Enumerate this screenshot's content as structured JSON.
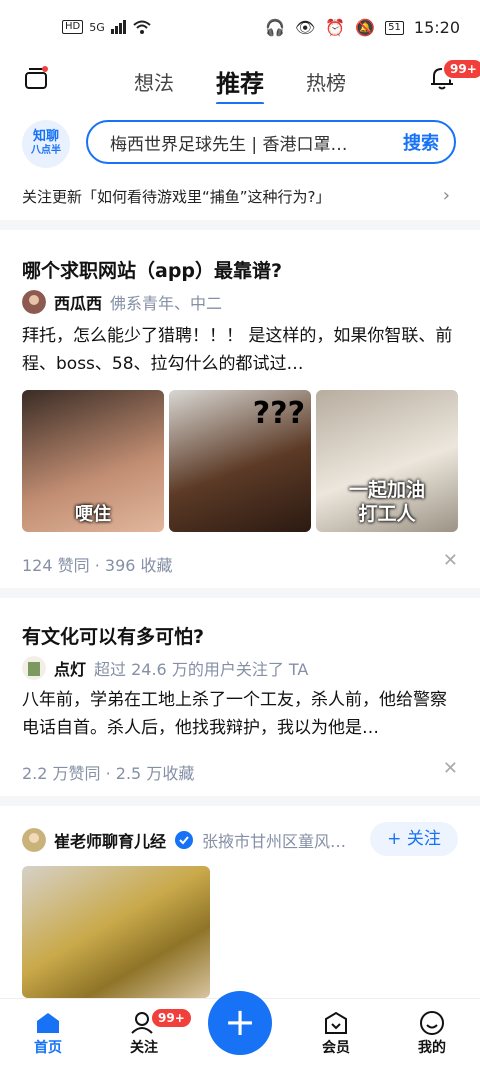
{
  "status_bar": {
    "hd": "HD",
    "network": "5G",
    "battery": "51",
    "time": "15:20"
  },
  "header": {
    "tabs": [
      {
        "label": "想法",
        "active": false
      },
      {
        "label": "推荐",
        "active": true
      },
      {
        "label": "热榜",
        "active": false
      }
    ],
    "notification_badge": "99+"
  },
  "search": {
    "logo_line1": "知聊",
    "logo_line2": "八点半",
    "query": "梅西世界足球先生 | 香港口罩…",
    "button_label": "搜索"
  },
  "follow_update": {
    "text": "关注更新「如何看待游戏里“捕鱼”这种行为?」"
  },
  "feed": [
    {
      "title": "哪个求职网站（app）最靠谱?",
      "author": "西瓜西",
      "author_desc": "佛系青年、中二",
      "excerpt": "拜托，怎么能少了猎聘！！！ 是这样的，如果你智联、前程、boss、58、拉勾什么的都试过…",
      "image_captions": [
        "哽住",
        "???",
        "一起加油\n打工人"
      ],
      "meta": "124 赞同 · 396 收藏"
    },
    {
      "title": "有文化可以有多可怕?",
      "author": "点灯",
      "author_desc": "超过 24.6 万的用户关注了 TA",
      "excerpt": "八年前，学弟在工地上杀了一个工友，杀人前，他给警察电话自首。杀人后，他找我辩护，我以为他是…",
      "meta": "2.2 万赞同 · 2.5 万收藏"
    },
    {
      "author": "崔老师聊育儿经",
      "author_desc": "张掖市甘州区童风…",
      "follow_label": "+ 关注"
    }
  ],
  "bottom_nav": {
    "items": [
      {
        "label": "首页",
        "active": true
      },
      {
        "label": "关注",
        "badge": "99+"
      },
      {
        "label": "会员"
      },
      {
        "label": "我的"
      }
    ],
    "plus": "+"
  },
  "colors": {
    "accent": "#1772f6",
    "badge": "#f1403c",
    "meta": "#8590a6"
  }
}
